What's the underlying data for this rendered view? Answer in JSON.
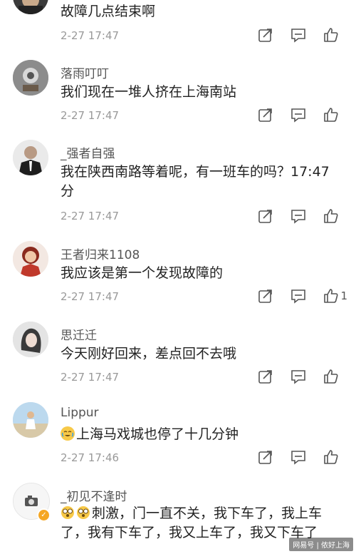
{
  "comments": [
    {
      "username": "",
      "text": "故障几点结束啊",
      "time": "2-27 17:47",
      "likes": ""
    },
    {
      "username": "落雨叮叮",
      "text": "我们现在一堆人挤在上海南站",
      "time": "2-27 17:47",
      "likes": ""
    },
    {
      "username": "_强者自强",
      "text": "我在陕西南路等着呢，有一班车的吗？17:47分",
      "time": "2-27 17:47",
      "likes": ""
    },
    {
      "username": "王者归来1108",
      "text": "我应该是第一个发现故障的",
      "time": "2-27 17:47",
      "likes": "1"
    },
    {
      "username": "思迁迁",
      "text": "今天刚好回来，差点回不去哦",
      "time": "2-27 17:47",
      "likes": ""
    },
    {
      "username": "Lippur",
      "text": "上海马戏城也停了十几分钟",
      "time": "2-27 17:46",
      "likes": ""
    },
    {
      "username": "_初见不逢时",
      "text": "刺激，门一直不关，我下车了，我上车了，我有下车了，我又上车了，我又下车了",
      "time": "",
      "likes": ""
    }
  ],
  "watermark": "网易号 | 侬好上海",
  "icons": {
    "repost": "repost-icon",
    "comment": "comment-icon",
    "like": "like-icon",
    "cry_emoji": "crying-laugh-emoji-icon",
    "dizzy_emoji": "dizzy-face-emoji-icon",
    "verified": "verified-badge-icon"
  },
  "colors": {
    "text": "#222222",
    "meta": "#999999",
    "icon": "#555555",
    "badge": "#f5a623"
  }
}
